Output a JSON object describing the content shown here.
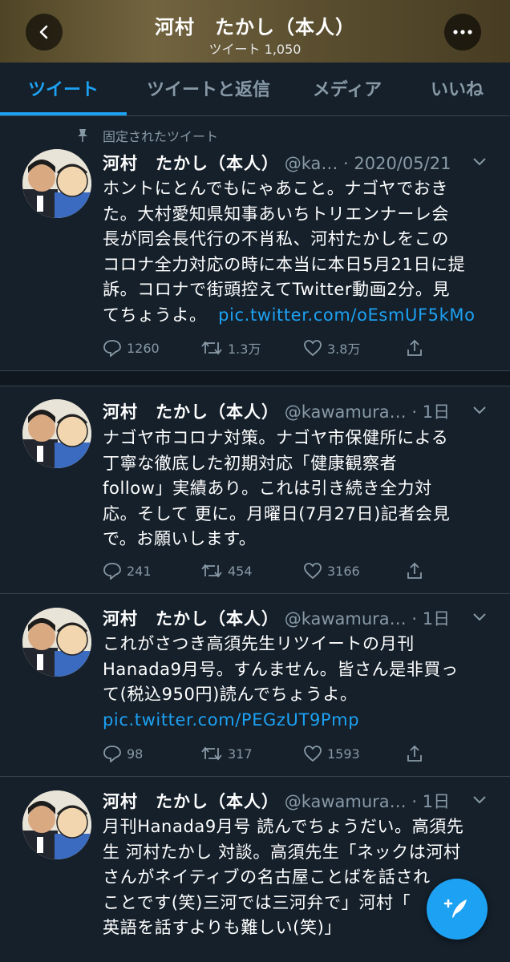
{
  "header": {
    "title": "河村　たかし（本人）",
    "subtitle": "ツイート 1,050"
  },
  "tabs": [
    {
      "label": "ツイート",
      "active": true
    },
    {
      "label": "ツイートと返信",
      "active": false
    },
    {
      "label": "メディア",
      "active": false
    },
    {
      "label": "いいね",
      "active": false
    }
  ],
  "pinned_label": "固定されたツイート",
  "tweets": [
    {
      "name": "河村　たかし（本人）",
      "handle": "@ka…",
      "time": "· 2020/05/21",
      "text": "ホントにとんでもにゃあこと。ナゴヤでおきた。大村愛知県知事あいちトリエンナーレ会長が同会長代行の不肖私、河村たかしをこのコロナ全力対応の時に本当に本日5月21日に提訴。コロナで街頭控えてTwitter動画2分。見てちょうよ。",
      "link": "pic.twitter.com/oEsmUF5kMo",
      "replies": "1260",
      "retweets": "1.3万",
      "likes": "3.8万"
    },
    {
      "name": "河村　たかし（本人）",
      "handle": "@kawamura…",
      "time": "· 1日",
      "text": "ナゴヤ市コロナ対策。ナゴヤ市保健所による丁寧な徹底した初期対応「健康観察者follow」実績あり。これは引き続き全力対応。そして 更に。月曜日(7月27日)記者会見で。お願いします。",
      "link": "",
      "replies": "241",
      "retweets": "454",
      "likes": "3166"
    },
    {
      "name": "河村　たかし（本人）",
      "handle": "@kawamura…",
      "time": "· 1日",
      "text": "これがさつき高須先生リツイートの月刊Hanada9月号。すんません。皆さん是非買って(税込950円)読んでちょうよ。",
      "link": "pic.twitter.com/PEGzUT9Pmp",
      "replies": "98",
      "retweets": "317",
      "likes": "1593"
    },
    {
      "name": "河村　たかし（本人）",
      "handle": "@kawamura…",
      "time": "· 1日",
      "text": "月刊Hanada9月号 読んでちょうだい。高須先生 河村たかし 対談。高須先生「ネックは河村さんがネイティブの名古屋ことばを話されることです(笑)三河では三河弁で」河村「…英語を話すよりも難しい(笑)」"
    }
  ],
  "lines": {
    "t0": [
      "ホントにとんでもにゃあこと。ナゴヤでおき",
      "た。大村愛知県知事あいちトリエンナーレ会",
      "長が同会長代行の不肖私、河村たかしをこの",
      "コロナ全力対応の時に本当に本日5月21日に提",
      "訴。コロナで街頭控えてTwitter動画2分。見",
      "てちょうよ。"
    ],
    "t1": [
      "ナゴヤ市コロナ対策。ナゴヤ市保健所による",
      "丁寧な徹底した初期対応「健康観察者",
      "follow」実績あり。これは引き続き全力対",
      "応。そして 更に。月曜日(7月27日)記者会見",
      "で。お願いします。"
    ],
    "t2": [
      "これがさつき高須先生リツイートの月刊",
      "Hanada9月号。すんません。皆さん是非買っ",
      "て(税込950円)読んでちょうよ。"
    ],
    "t3": [
      "月刊Hanada9月号 読んでちょうだい。高須先",
      "生 河村たかし 対談。高須先生「ネックは河村",
      "さんがネイティブの名古屋ことばを話され",
      "ことです(笑)三河では三河弁で」河村「",
      "英語を話すよりも難しい(笑)」"
    ]
  },
  "colors": {
    "background": "#15202b",
    "accent": "#1da1f2",
    "muted": "#8899a6",
    "divider": "#38444d"
  },
  "icons": {
    "back": "chevron-left-icon",
    "more": "more-icon",
    "pin": "pin-icon",
    "reply": "reply-icon",
    "retweet": "retweet-icon",
    "like": "like-icon",
    "share": "share-icon",
    "compose": "compose-icon"
  }
}
